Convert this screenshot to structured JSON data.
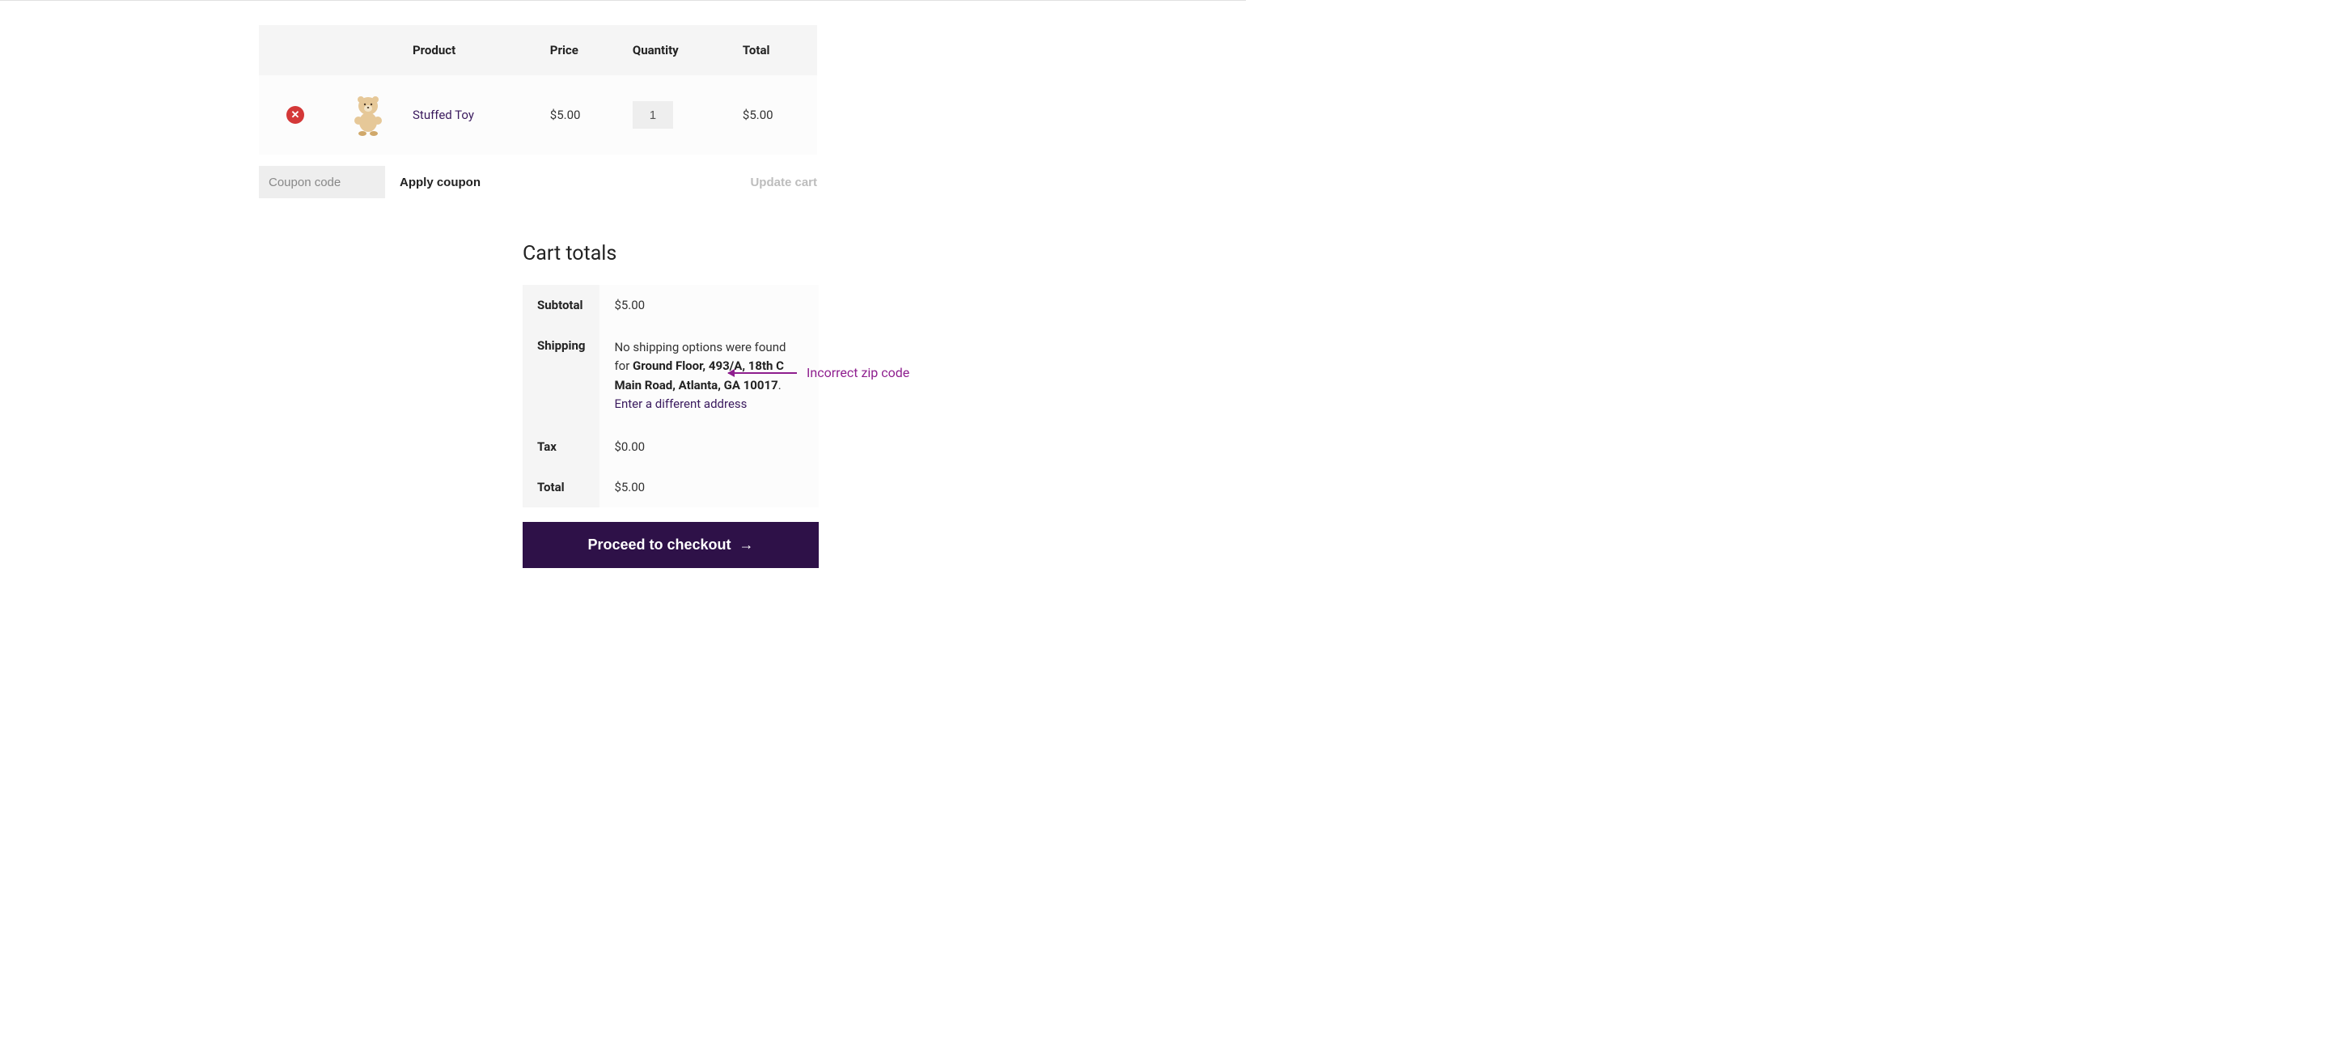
{
  "cart_table": {
    "headers": {
      "product": "Product",
      "price": "Price",
      "quantity": "Quantity",
      "total": "Total"
    },
    "items": [
      {
        "remove_icon": "x-circle-icon",
        "product_name": "Stuffed Toy",
        "price": "$5.00",
        "quantity": "1",
        "total": "$5.00"
      }
    ]
  },
  "coupon": {
    "placeholder": "Coupon code",
    "apply_label": "Apply coupon"
  },
  "update_cart_label": "Update cart",
  "cart_totals": {
    "title": "Cart totals",
    "rows": {
      "subtotal_label": "Subtotal",
      "subtotal_value": "$5.00",
      "shipping_label": "Shipping",
      "shipping_prefix": "No shipping options were found for ",
      "shipping_address": "Ground Floor, 493/A, 18th C Main Road, Atlanta, GA 10017",
      "shipping_suffix": ".",
      "enter_address_link": "Enter a different address",
      "tax_label": "Tax",
      "tax_value": "$0.00",
      "total_label": "Total",
      "total_value": "$5.00"
    },
    "checkout_label": "Proceed to checkout"
  },
  "annotation": {
    "text": "Incorrect zip code"
  }
}
